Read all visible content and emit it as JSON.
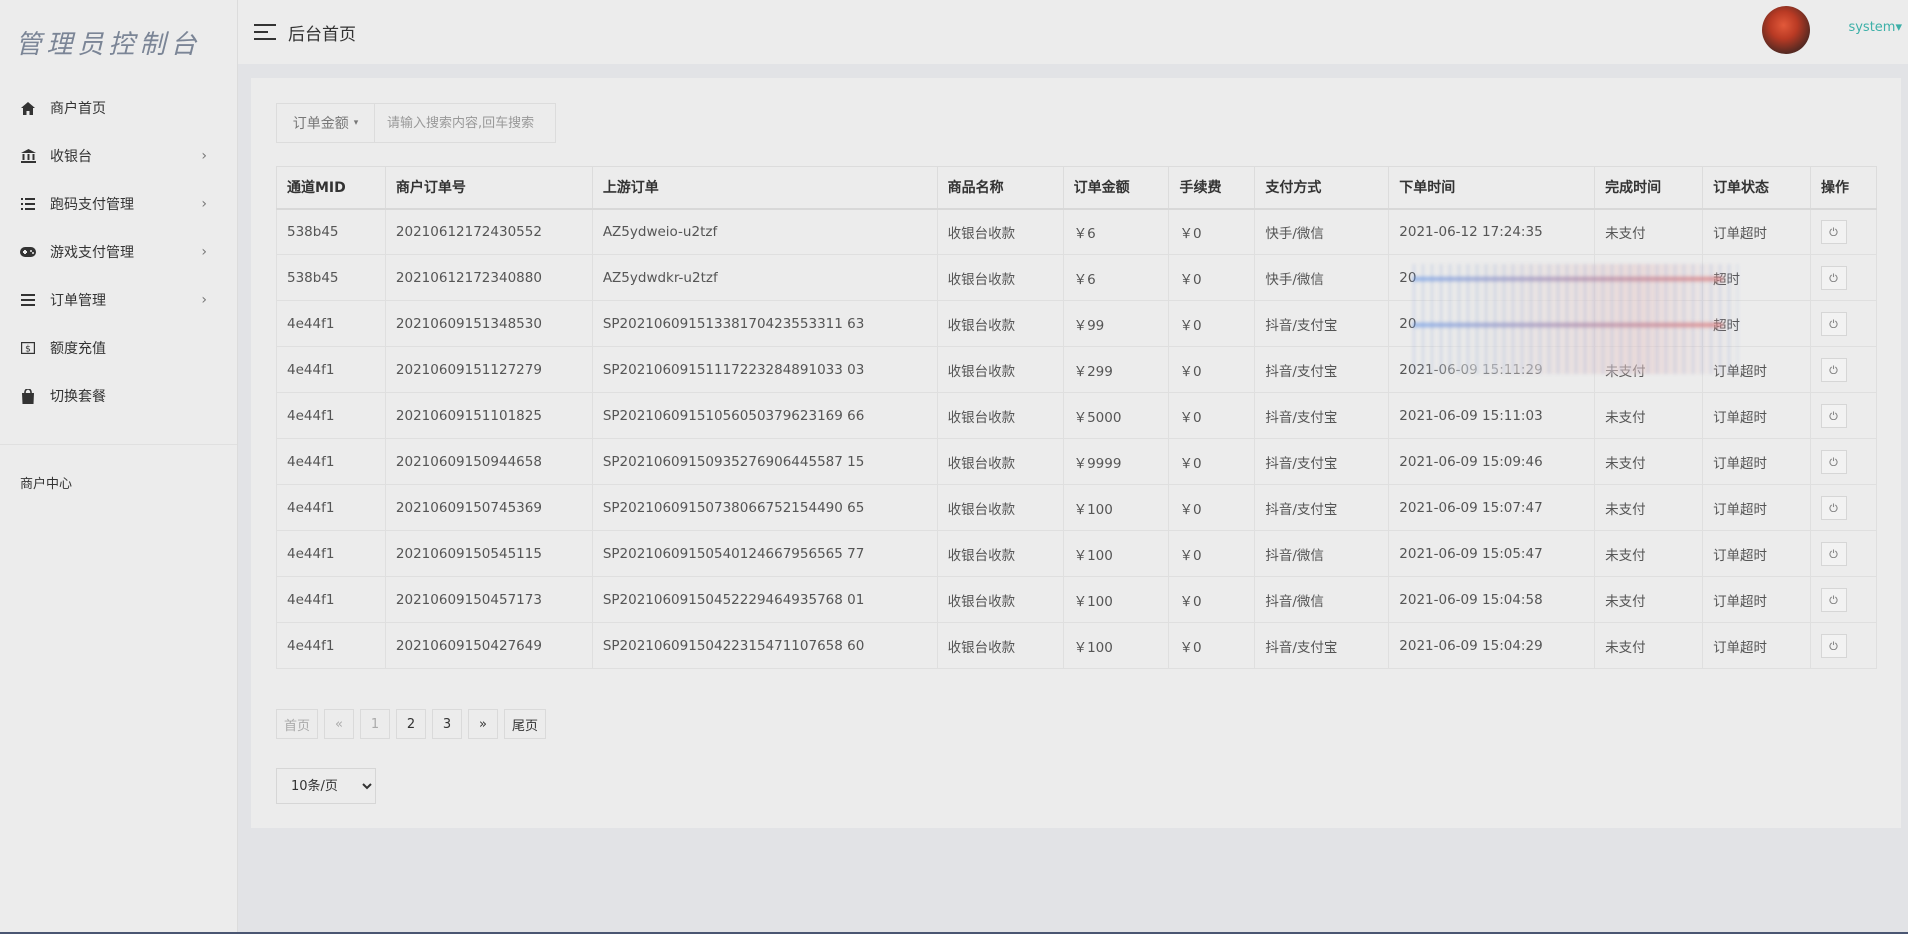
{
  "sidebar": {
    "logo": "管理员控制台",
    "items": [
      {
        "label": "商户首页",
        "icon": "home-icon",
        "chevron": ""
      },
      {
        "label": "收银台",
        "icon": "bank-icon",
        "chevron": "›"
      },
      {
        "label": "跑码支付管理",
        "icon": "list-icon",
        "chevron": "›"
      },
      {
        "label": "游戏支付管理",
        "icon": "gamepad-icon",
        "chevron": "›"
      },
      {
        "label": "订单管理",
        "icon": "bars-icon",
        "chevron": "›"
      },
      {
        "label": "额度充值",
        "icon": "money-icon",
        "chevron": ""
      },
      {
        "label": "切换套餐",
        "icon": "shopping-bag-icon",
        "chevron": ""
      }
    ],
    "section_label": "商户中心"
  },
  "header": {
    "title": "后台首页",
    "username": "system",
    "username_caret": "▾"
  },
  "search": {
    "field_select": "订单金额",
    "caret": "▾",
    "placeholder": "请输入搜索内容,回车搜索"
  },
  "table": {
    "columns": [
      "通道MID",
      "商户订单号",
      "上游订单",
      "商品名称",
      "订单金额",
      "手续费",
      "支付方式",
      "下单时间",
      "完成时间",
      "订单状态",
      "操作"
    ],
    "rows": [
      [
        "538b45",
        "20210612172430552",
        "AZ5ydweio-u2tzf",
        "收银台收款",
        "￥6",
        "￥0",
        "快手/微信",
        "2021-06-12 17:24:35",
        "未支付",
        "订单超时"
      ],
      [
        "538b45",
        "20210612172340880",
        "AZ5ydwdkr-u2tzf",
        "收银台收款",
        "￥6",
        "￥0",
        "快手/微信",
        "20",
        "",
        "超时"
      ],
      [
        "4e44f1",
        "20210609151348530",
        "SP20210609151338170423553311 63",
        "收银台收款",
        "￥99",
        "￥0",
        "抖音/支付宝",
        "20",
        "",
        "超时"
      ],
      [
        "4e44f1",
        "20210609151127279",
        "SP20210609151117223284891033 03",
        "收银台收款",
        "￥299",
        "￥0",
        "抖音/支付宝",
        "2021-06-09 15:11:29",
        "未支付",
        "订单超时"
      ],
      [
        "4e44f1",
        "20210609151101825",
        "SP20210609151056050379623169 66",
        "收银台收款",
        "￥5000",
        "￥0",
        "抖音/支付宝",
        "2021-06-09 15:11:03",
        "未支付",
        "订单超时"
      ],
      [
        "4e44f1",
        "20210609150944658",
        "SP20210609150935276906445587 15",
        "收银台收款",
        "￥9999",
        "￥0",
        "抖音/支付宝",
        "2021-06-09 15:09:46",
        "未支付",
        "订单超时"
      ],
      [
        "4e44f1",
        "20210609150745369",
        "SP20210609150738066752154490 65",
        "收银台收款",
        "￥100",
        "￥0",
        "抖音/支付宝",
        "2021-06-09 15:07:47",
        "未支付",
        "订单超时"
      ],
      [
        "4e44f1",
        "20210609150545115",
        "SP20210609150540124667956565 77",
        "收银台收款",
        "￥100",
        "￥0",
        "抖音/微信",
        "2021-06-09 15:05:47",
        "未支付",
        "订单超时"
      ],
      [
        "4e44f1",
        "20210609150457173",
        "SP20210609150452229464935768 01",
        "收银台收款",
        "￥100",
        "￥0",
        "抖音/微信",
        "2021-06-09 15:04:58",
        "未支付",
        "订单超时"
      ],
      [
        "4e44f1",
        "20210609150427649",
        "SP20210609150422315471107658 60",
        "收银台收款",
        "￥100",
        "￥0",
        "抖音/支付宝",
        "2021-06-09 15:04:29",
        "未支付",
        "订单超时"
      ]
    ]
  },
  "pagination": {
    "first": "首页",
    "prev": "«",
    "pages": [
      "1",
      "2",
      "3"
    ],
    "next": "»",
    "last": "尾页"
  },
  "page_size": {
    "selected": "10条/页",
    "options": [
      "10条/页"
    ]
  },
  "colors": {
    "unpaid": "#f0a05a",
    "timeout": "#ec4a4a",
    "username": "#3db0a8"
  }
}
